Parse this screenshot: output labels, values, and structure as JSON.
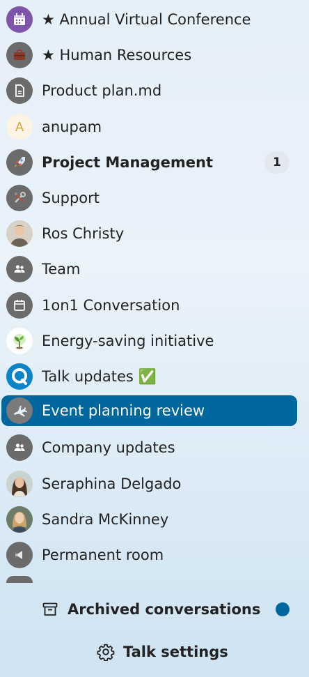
{
  "conversations": [
    {
      "label": "★ Annual Virtual Conference",
      "icon": "calendar-event-icon",
      "bold": false
    },
    {
      "label": "★ Human Resources",
      "icon": "briefcase-icon",
      "bold": false
    },
    {
      "label": "Product plan.md",
      "icon": "document-icon",
      "bold": false
    },
    {
      "label": "anupam",
      "icon": "initial-avatar",
      "initial": "A",
      "bold": false
    },
    {
      "label": "Project Management",
      "icon": "rocket-icon",
      "bold": true,
      "badge": "1"
    },
    {
      "label": "Support",
      "icon": "tools-icon",
      "bold": false
    },
    {
      "label": "Ros Christy",
      "icon": "user-photo-avatar",
      "bold": false
    },
    {
      "label": "Team",
      "icon": "group-icon",
      "bold": false
    },
    {
      "label": "1on1 Conversation",
      "icon": "calendar-icon",
      "bold": false
    },
    {
      "label": "Energy-saving initiative",
      "icon": "plant-icon",
      "bold": false
    },
    {
      "label": "Talk updates ✅",
      "icon": "talk-logo-icon",
      "bold": false
    },
    {
      "label": "Event planning review",
      "icon": "airplane-icon",
      "bold": false,
      "active": true
    },
    {
      "label": "Company updates",
      "icon": "group-icon",
      "bold": false
    },
    {
      "label": "Seraphina Delgado",
      "icon": "user-photo-avatar",
      "bold": false
    },
    {
      "label": "Sandra McKinney",
      "icon": "user-photo-avatar",
      "bold": false
    },
    {
      "label": "Permanent room",
      "icon": "megaphone-icon",
      "bold": false
    }
  ],
  "footer": {
    "archived_label": "Archived conversations",
    "settings_label": "Talk settings"
  },
  "colors": {
    "accent": "#00679e",
    "avatar_gray": "#6b6b6b",
    "calendar_purple": "#7e55a8",
    "badge_bg": "#e3e8ee"
  }
}
